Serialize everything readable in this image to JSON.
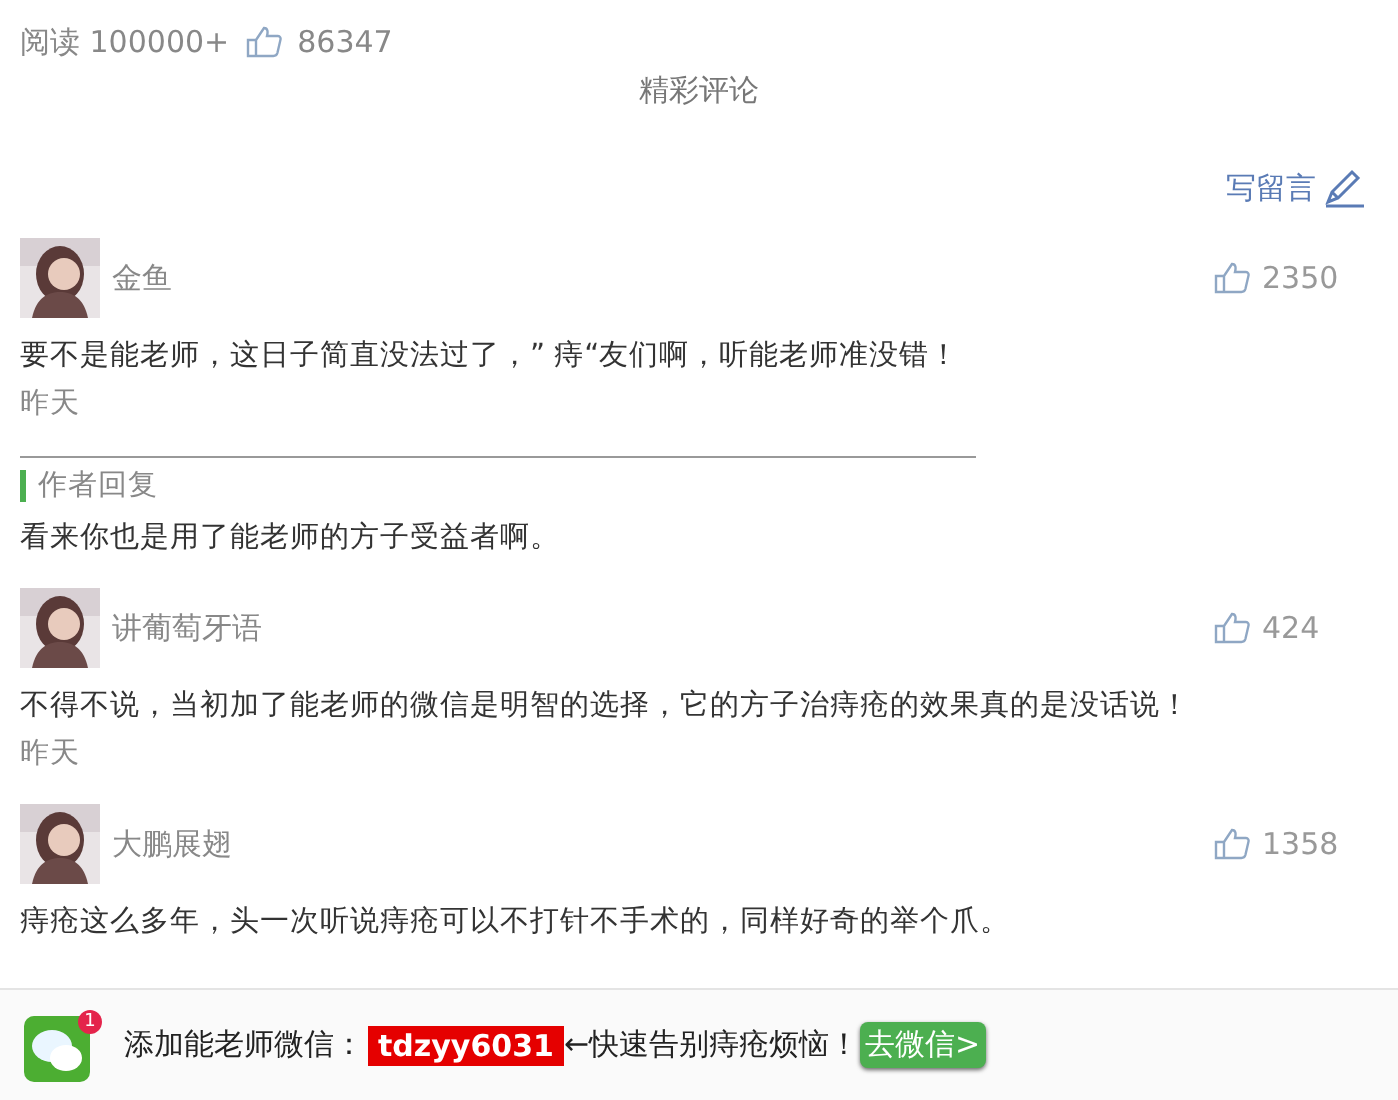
{
  "stats": {
    "reads": "阅读 100000+",
    "likes": "86347"
  },
  "section_title": "精彩评论",
  "write_comment": "写留言",
  "comments": [
    {
      "user": "金鱼",
      "likes": "2350",
      "text": "要不是能老师，这日子简直没法过了，” 痔“友们啊，听能老师准没错！",
      "time": "昨天",
      "reply": {
        "label": "作者回复",
        "text": "看来你也是用了能老师的方子受益者啊。"
      }
    },
    {
      "user": "讲葡萄牙语",
      "likes": "424",
      "text": "不得不说，当初加了能老师的微信是明智的选择，它的方子治痔疮的效果真的是没话说！",
      "time": "昨天"
    },
    {
      "user": "大鹏展翅",
      "likes": "1358",
      "text": "痔疮这么多年，头一次听说痔疮可以不打针不手术的，同样好奇的举个爪。"
    }
  ],
  "banner": {
    "badge": "1",
    "lead": "添加能老师微信：",
    "wechat_id": "tdzyy6031",
    "tail": "←快速告别痔疮烦恼！",
    "button": "去微信>"
  }
}
